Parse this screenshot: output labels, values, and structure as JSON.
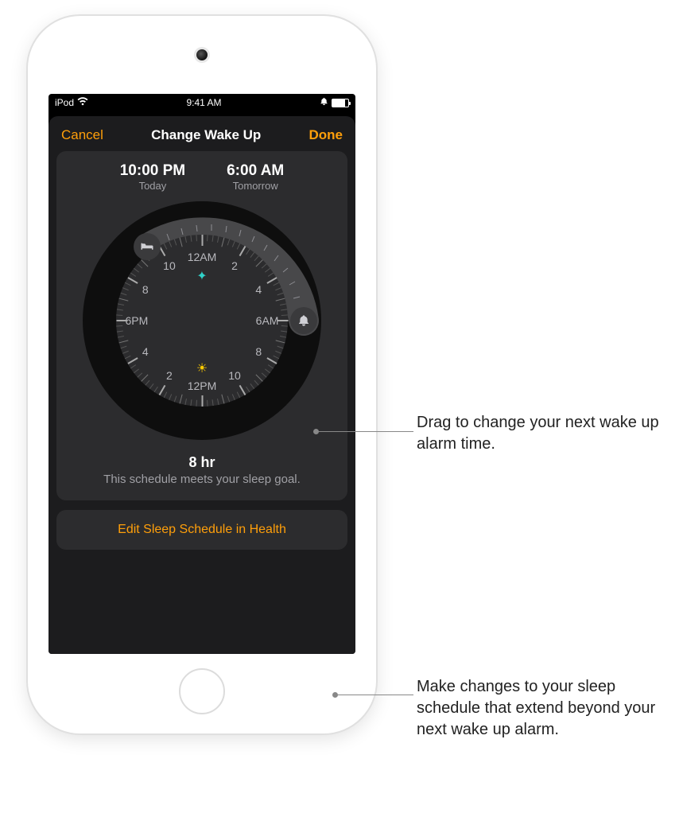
{
  "status": {
    "carrier": "iPod",
    "time": "9:41 AM"
  },
  "nav": {
    "cancel": "Cancel",
    "title": "Change Wake Up",
    "done": "Done"
  },
  "bedtime": {
    "time": "10:00 PM",
    "day": "Today"
  },
  "wake": {
    "time": "6:00 AM",
    "day": "Tomorrow"
  },
  "face": {
    "h12am": "12AM",
    "h2t": "2",
    "h4t": "4",
    "h6am": "6AM",
    "h8b": "8",
    "h10b": "10",
    "h12pm": "12PM",
    "h2b": "2",
    "h4b2": "4",
    "h6pm": "6PM",
    "h8t": "8",
    "h10t": "10"
  },
  "goal": {
    "hours": "8 hr",
    "message": "This schedule meets your sleep goal."
  },
  "edit": {
    "label": "Edit Sleep Schedule in Health"
  },
  "callouts": {
    "c1": "Drag to change your next wake up alarm time.",
    "c2": "Make changes to your sleep schedule that extend beyond your next wake up alarm."
  }
}
